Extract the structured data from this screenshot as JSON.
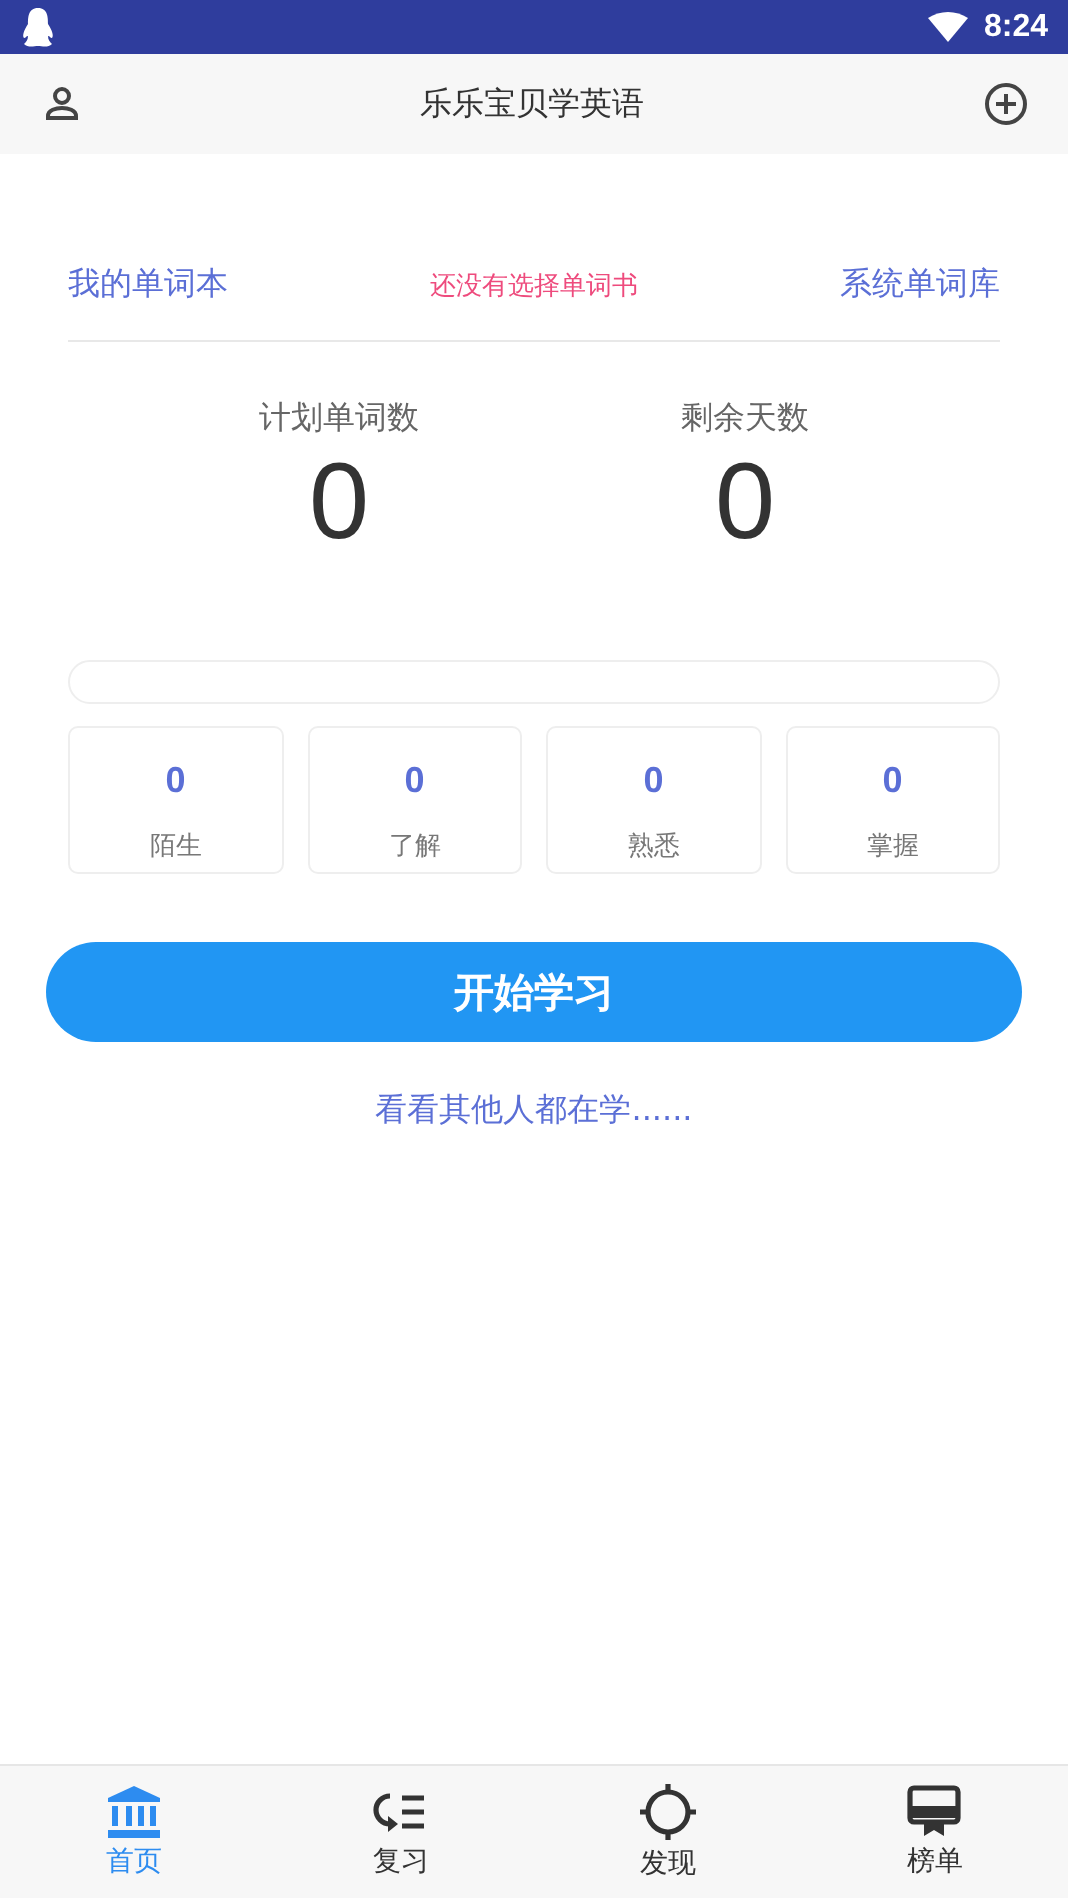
{
  "status_bar": {
    "time": "8:24"
  },
  "app_bar": {
    "title": "乐乐宝贝学英语"
  },
  "book_row": {
    "left_link": "我的单词本",
    "notice": "还没有选择单词书",
    "right_link": "系统单词库"
  },
  "stats": [
    {
      "label": "计划单词数",
      "value": "0"
    },
    {
      "label": "剩余天数",
      "value": "0"
    }
  ],
  "progress": {
    "level": 0
  },
  "levels": [
    {
      "count": "0",
      "label": "陌生"
    },
    {
      "count": "0",
      "label": "了解"
    },
    {
      "count": "0",
      "label": "熟悉"
    },
    {
      "count": "0",
      "label": "掌握"
    }
  ],
  "start_button": "开始学习",
  "others_link": "看看其他人都在学......",
  "bottom_nav": [
    {
      "kind": "home",
      "label": "首页",
      "selected": true
    },
    {
      "kind": "review",
      "label": "复习",
      "selected": false
    },
    {
      "kind": "discover",
      "label": "发现",
      "selected": false
    },
    {
      "kind": "rank",
      "label": "榜单",
      "selected": false
    }
  ]
}
